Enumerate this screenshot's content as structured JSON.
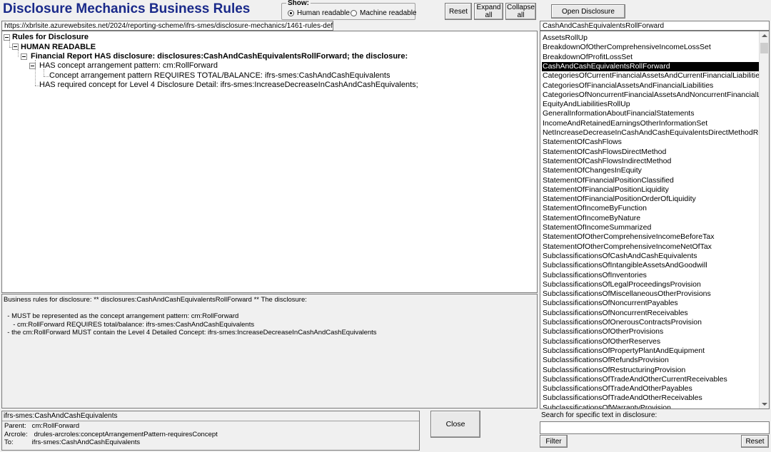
{
  "title": "Disclosure Mechanics Business Rules",
  "show": {
    "legend": "Show:",
    "options": [
      {
        "label": "Human readable",
        "selected": true
      },
      {
        "label": "Machine readable",
        "selected": false
      }
    ]
  },
  "toolbar": {
    "reset_label": "Reset",
    "expand_label": "Expand all",
    "collapse_label": "Collapse all",
    "open_label": "Open Disclosure"
  },
  "url": "https://xbrlsite.azurewebsites.net/2024/reporting-scheme/ifrs-smes/disclosure-mechanics/1461-rules-def.xml",
  "selected_disclosure": "CashAndCashEquivalentsRollForward",
  "tree": {
    "root": "Rules for Disclosure",
    "human": "HUMAN READABLE",
    "report": "Financial Report HAS disclosure: disclosures:CashAndCashEquivalentsRollForward; the disclosure:",
    "pattern": "HAS concept arrangement pattern: cm:RollForward",
    "requires": "Concept arrangement pattern REQUIRES TOTAL/BALANCE: ifrs-smes:CashAndCashEquivalents",
    "detail": "HAS required concept for Level 4 Disclosure Detail: ifrs-smes:IncreaseDecreaseInCashAndCashEquivalents;"
  },
  "description": [
    "Business rules for disclosure: ** disclosures:CashAndCashEquivalentsRollForward ** The disclosure:",
    "",
    "  - MUST be represented as the concept arrangement pattern: cm:RollForward",
    "     - cm:RollForward REQUIRES total/balance: ifrs-smes:CashAndCashEquivalents",
    "  - the cm:RollForward MUST contain the Level 4 Detailed Concept: ifrs-smes:IncreaseDecreaseInCashAndCashEquivalents"
  ],
  "disclosures": [
    "AssetsRollUp",
    "BreakdownOfOtherComprehensiveIncomeLossSet",
    "BreakdownOfProfitLossSet",
    "CashAndCashEquivalentsRollForward",
    "CategoriesOfCurrentFinancialAssetsAndCurrentFinancialLiabilities",
    "CategoriesOfFinancialAssetsAndFinancialLiabilities",
    "CategoriesOfNoncurrentFinancialAssetsAndNoncurrentFinancialLia",
    "EquityAndLiabilitiesRollUp",
    "GeneralInformationAboutFinancialStatements",
    "IncomeAndRetainedEarningsOtherInformationSet",
    "NetIncreaseDecreaseInCashAndCashEquivalentsDirectMethodRol",
    "StatementOfCashFlows",
    "StatementOfCashFlowsDirectMethod",
    "StatementOfCashFlowsIndirectMethod",
    "StatementOfChangesInEquity",
    "StatementOfFinancialPositionClassified",
    "StatementOfFinancialPositionLiquidity",
    "StatementOfFinancialPositionOrderOfLiquidity",
    "StatementOfIncomeByFunction",
    "StatementOfIncomeByNature",
    "StatementOfIncomeSummarized",
    "StatementOfOtherComprehensiveIncomeBeforeTax",
    "StatementOfOtherComprehensiveIncomeNetOfTax",
    "SubclassificationsOfCashAndCashEquivalents",
    "SubclassificationsOfIntangibleAssetsAndGoodwill",
    "SubclassificationsOfInventories",
    "SubclassificationsOfLegalProceedingsProvision",
    "SubclassificationsOfMiscellaneousOtherProvisions",
    "SubclassificationsOfNoncurrentPayables",
    "SubclassificationsOfNoncurrentReceivables",
    "SubclassificationsOfOnerousContractsProvision",
    "SubclassificationsOfOtherProvisions",
    "SubclassificationsOfOtherReserves",
    "SubclassificationsOfPropertyPlantAndEquipment",
    "SubclassificationsOfRefundsProvision",
    "SubclassificationsOfRestructuringProvision",
    "SubclassificationsOfTradeAndOtherCurrentReceivables",
    "SubclassificationsOfTradeAndOtherPayables",
    "SubclassificationsOfTradeAndOtherReceivables",
    "SubclassificationsOfWarrantyProvision"
  ],
  "relationship": {
    "header": "ifrs-smes:CashAndCashEquivalents",
    "rows": [
      {
        "label": "Parent:",
        "value": "cm:RollForward"
      },
      {
        "label": "Arcrole:",
        "value": "drules-arcroles:conceptArrangementPattern-requiresConcept"
      },
      {
        "label": "To:",
        "value": "ifrs-smes:CashAndCashEquivalents"
      }
    ]
  },
  "close_label": "Close",
  "search": {
    "label": "Search for specific text in disclosure:",
    "value": "",
    "filter_label": "Filter",
    "reset_label": "Reset"
  }
}
